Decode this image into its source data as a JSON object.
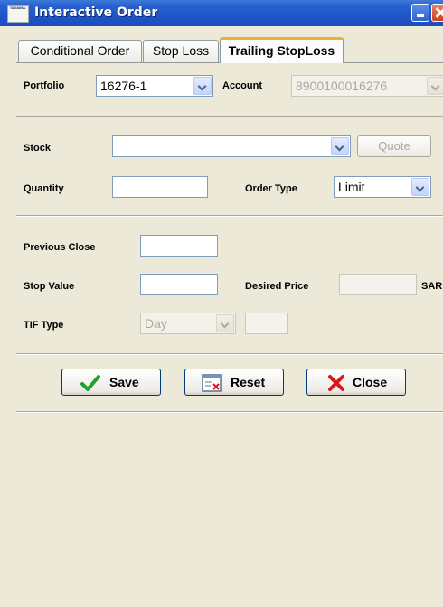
{
  "window": {
    "title": "Interactive Order",
    "icon_text": "TADAWUL"
  },
  "tabs": [
    {
      "label": "Conditional Order",
      "active": false
    },
    {
      "label": "Stop Loss",
      "active": false
    },
    {
      "label": "Trailing StopLoss",
      "active": true
    }
  ],
  "portfolio": {
    "label": "Portfolio",
    "value": "16276-1"
  },
  "account": {
    "label": "Account",
    "value": "8900100016276"
  },
  "stock": {
    "label": "Stock",
    "value": "",
    "quote_label": "Quote"
  },
  "quantity": {
    "label": "Quantity",
    "value": ""
  },
  "order_type": {
    "label": "Order Type",
    "value": "Limit"
  },
  "previous_close": {
    "label": "Previous Close",
    "value": ""
  },
  "stop_value": {
    "label": "Stop Value",
    "value": ""
  },
  "desired_price": {
    "label": "Desired Price",
    "value": "",
    "currency": "SAR"
  },
  "tif": {
    "label": "TIF Type",
    "value": "Day",
    "days": ""
  },
  "buttons": {
    "save": "Save",
    "reset": "Reset",
    "close": "Close"
  },
  "colors": {
    "title_bar": "#1f55c8",
    "save_check": "#22a02a",
    "close_x": "#d81818",
    "tab_active_accent": "#f0b030"
  }
}
